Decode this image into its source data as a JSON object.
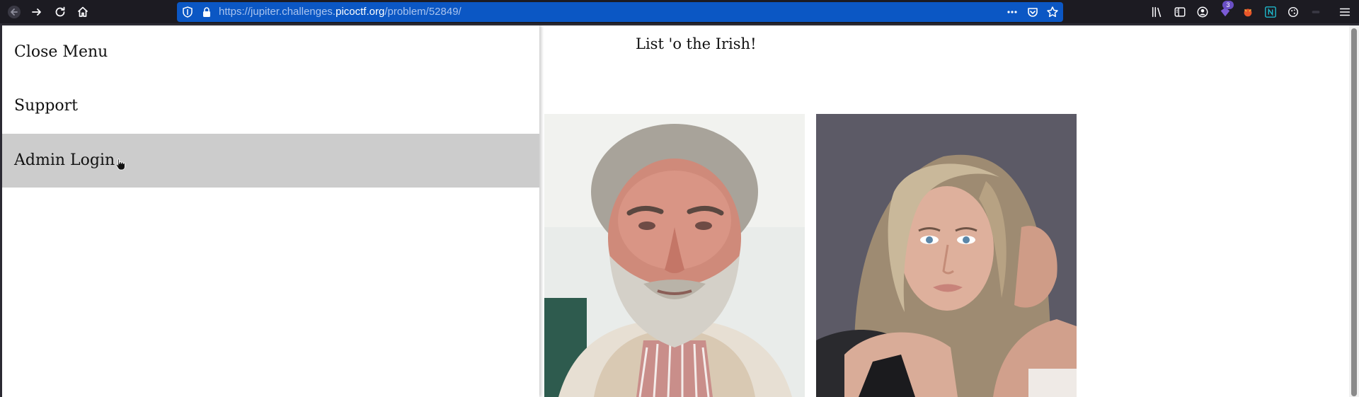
{
  "browser": {
    "url_prefix": "https://jupiter.challenges.",
    "url_domain": "picoctf.org",
    "url_path": "/problem/52849/",
    "extension_badge": "3",
    "icons": {
      "back": "back-arrow-icon",
      "forward": "forward-arrow-icon",
      "reload": "reload-icon",
      "home": "home-icon",
      "tracking": "tracking-protection-shield-icon",
      "lock": "lock-icon",
      "page_actions": "more-dots-icon",
      "pocket": "pocket-icon",
      "bookmark": "bookmark-star-icon",
      "library": "library-icon",
      "sidebar": "sidebar-icon",
      "account": "account-icon",
      "menu": "hamburger-menu-icon"
    }
  },
  "menu": {
    "items": [
      {
        "label": "Close Menu"
      },
      {
        "label": "Support"
      },
      {
        "label": "Admin Login"
      }
    ],
    "hover_index": 2
  },
  "page": {
    "title": "List 'o the Irish!"
  },
  "colors": {
    "toolbar_bg": "#1c1b22",
    "urlbar_bg": "#0b57c4",
    "menu_hover": "#cccccc",
    "badge": "#6a4fc4"
  }
}
